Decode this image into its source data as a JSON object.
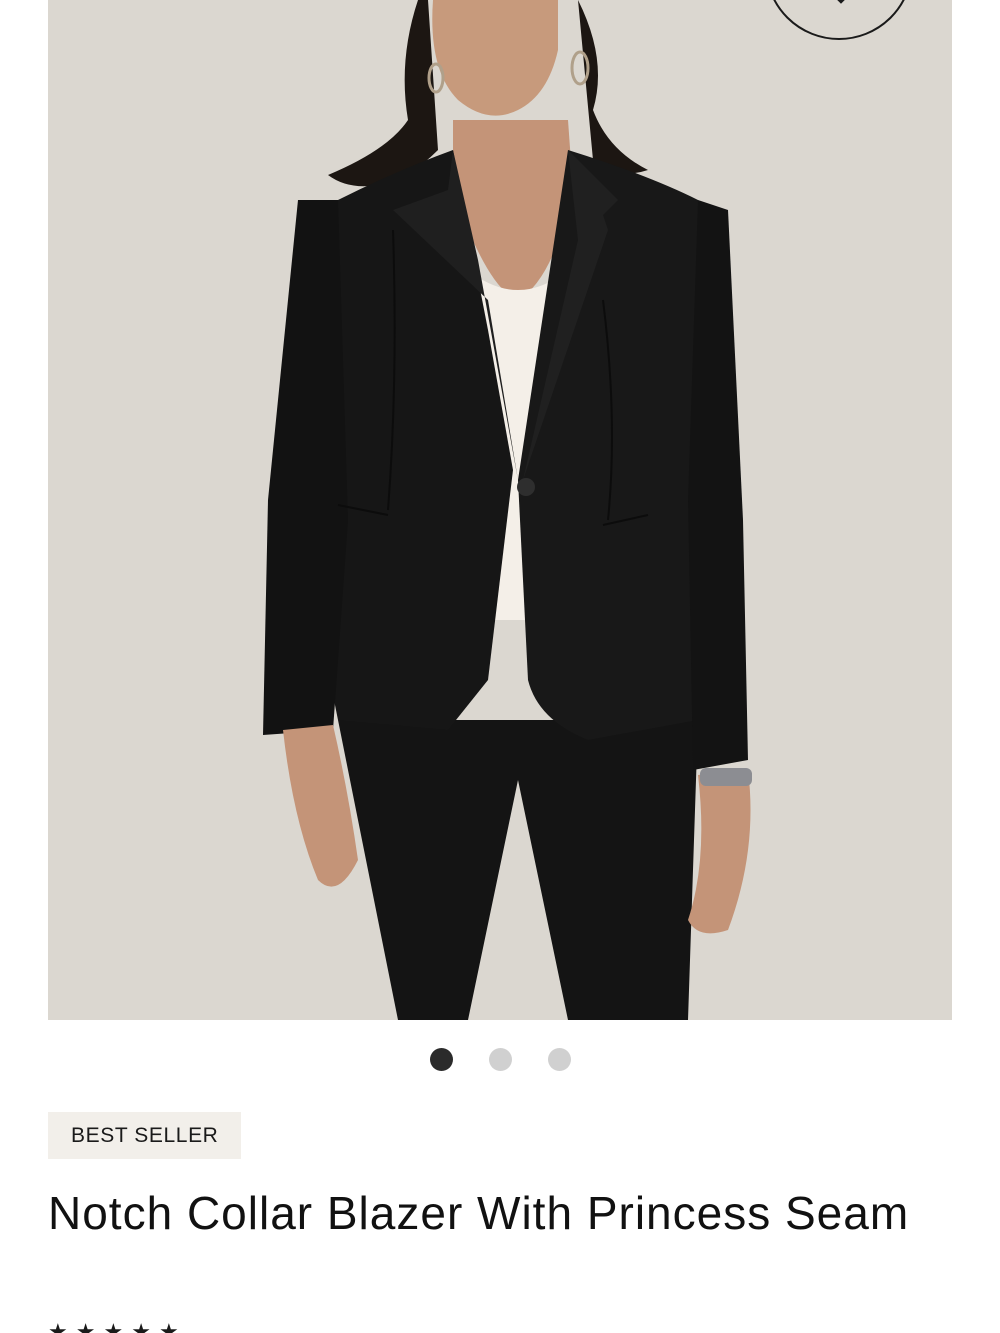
{
  "product": {
    "badge": "BEST SELLER",
    "title": "Notch Collar Blazer With Princess Seam",
    "image_alt": "Model wearing black notch collar blazer with white top and black pants",
    "rating_icon": "star-icon"
  },
  "carousel": {
    "count": 3,
    "active_index": 0
  },
  "colors": {
    "image_background": "#dbd7d0",
    "blazer": "#151515",
    "active_dot": "#2b2b2b",
    "inactive_dot": "#d0d0d0",
    "badge_background": "#f2efea"
  }
}
